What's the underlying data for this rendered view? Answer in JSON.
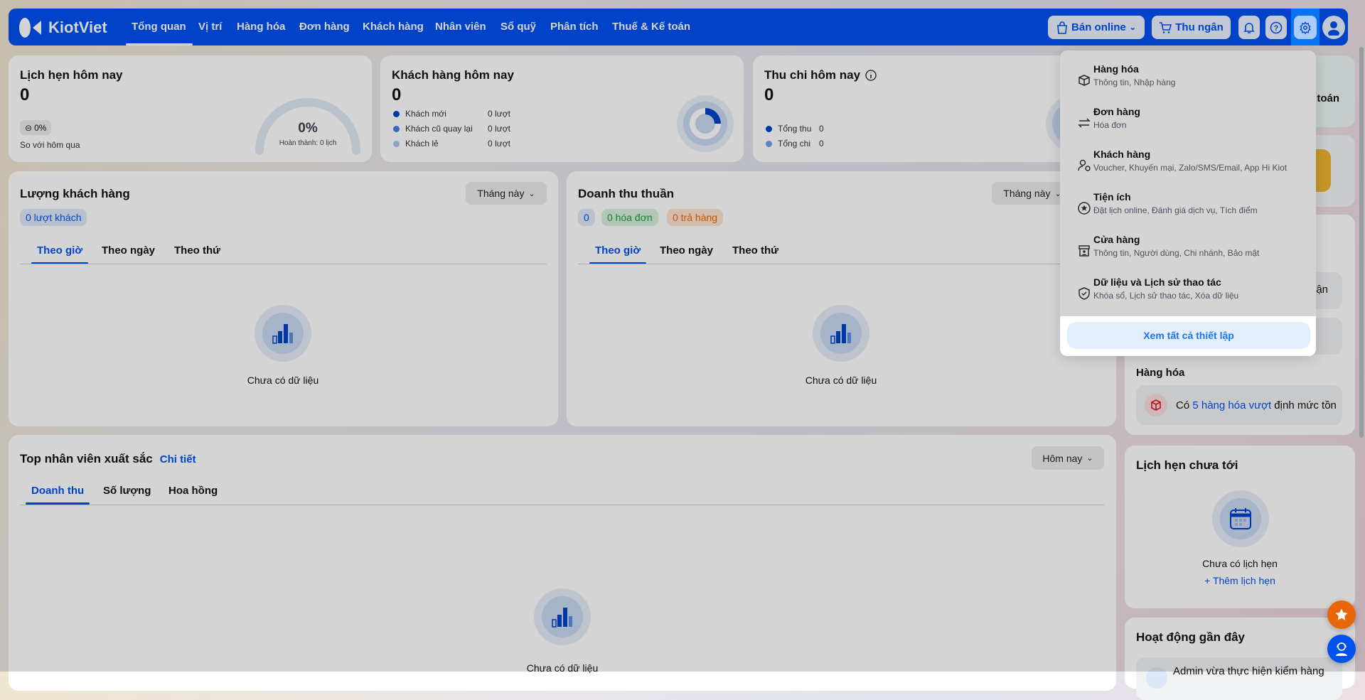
{
  "navbar": {
    "brand": "KiotViet",
    "items": [
      "Tổng quan",
      "Vị trí",
      "Hàng hóa",
      "Đơn hàng",
      "Khách hàng",
      "Nhân viên",
      "Sổ quỹ",
      "Phân tích",
      "Thuế & Kế toán"
    ],
    "active_index": 0,
    "ban_online": "Bán online",
    "thu_ngan": "Thu ngân"
  },
  "appointments_today": {
    "title": "Lịch hẹn hôm nay",
    "value": "0",
    "change": "0%",
    "compare": "So với hôm qua",
    "gauge_value": "0%",
    "gauge_caption": "Hoàn thành: 0 lịch",
    "progress": 0
  },
  "customers_today": {
    "title": "Khách hàng hôm nay",
    "value": "0",
    "legend": [
      {
        "label": "Khách mới",
        "value": "0 lượt",
        "color": "#0043c8"
      },
      {
        "label": "Khách cũ quay lại",
        "value": "0 lượt",
        "color": "#3b82e6"
      },
      {
        "label": "Khách lẻ",
        "value": "0 lượt",
        "color": "#a9c4ee"
      }
    ]
  },
  "cashflow_today": {
    "title": "Thu chi hôm nay",
    "value": "0",
    "legend": [
      {
        "label": "Tổng thu",
        "value": "0",
        "color": "#0043c8"
      },
      {
        "label": "Tổng chi",
        "value": "0",
        "color": "#6fa0e8"
      }
    ]
  },
  "customer_volume": {
    "title": "Lượng khách hàng",
    "period": "Tháng này",
    "pill": "0 lượt khách",
    "tabs": [
      "Theo giờ",
      "Theo ngày",
      "Theo thứ"
    ],
    "empty": "Chưa có dữ liệu"
  },
  "net_revenue": {
    "title": "Doanh thu thuần",
    "period": "Tháng này",
    "pills": [
      "0",
      "0 hóa đơn",
      "0 trả hàng"
    ],
    "tabs": [
      "Theo giờ",
      "Theo ngày",
      "Theo thứ"
    ],
    "empty": "Chưa có dữ liệu"
  },
  "top_staff": {
    "title": "Top nhân viên xuất sắc",
    "detail": "Chi tiết",
    "period": "Hôm nay",
    "tabs": [
      "Doanh thu",
      "Số lượng",
      "Hoa hồng"
    ],
    "empty": "Chưa có dữ liệu"
  },
  "right": {
    "card1_fragment": "toán",
    "card3_fragment": "ận",
    "goods_title": "Hàng hóa",
    "goods_pre": "Có ",
    "goods_link": "5 hàng hóa vượt",
    "goods_post": " định mức tồn",
    "upcoming_title": "Lịch hẹn chưa tới",
    "upcoming_empty": "Chưa có lịch hẹn",
    "upcoming_add": "+ Thêm lịch hẹn",
    "activity_title": "Hoạt động gần đây",
    "activity_item": "Admin vừa thực hiện kiểm hàng"
  },
  "settings_menu": {
    "items": [
      {
        "title": "Hàng hóa",
        "sub": "Thông tin, Nhập hàng",
        "icon": "box-icon"
      },
      {
        "title": "Đơn hàng",
        "sub": "Hóa đơn",
        "icon": "swap-icon"
      },
      {
        "title": "Khách hàng",
        "sub": "Voucher, Khuyến mại, Zalo/SMS/Email, App Hi Kiot",
        "icon": "user-icon"
      },
      {
        "title": "Tiện ích",
        "sub": "Đặt lịch online, Đánh giá dịch vụ, Tích điểm",
        "icon": "star-circle-icon"
      },
      {
        "title": "Cửa hàng",
        "sub": "Thông tin, Người dùng, Chi nhánh, Bảo mật",
        "icon": "store-icon"
      },
      {
        "title": "Dữ liệu và Lịch sử thao tác",
        "sub": "Khóa sổ, Lịch sử thao tác, Xóa dữ liệu",
        "icon": "shield-check-icon"
      }
    ],
    "view_all": "Xem tất cả thiết lập"
  },
  "colors": {
    "brand": "#0051f1",
    "accent_orange": "#e8650a",
    "green": "#1a9a3a"
  }
}
